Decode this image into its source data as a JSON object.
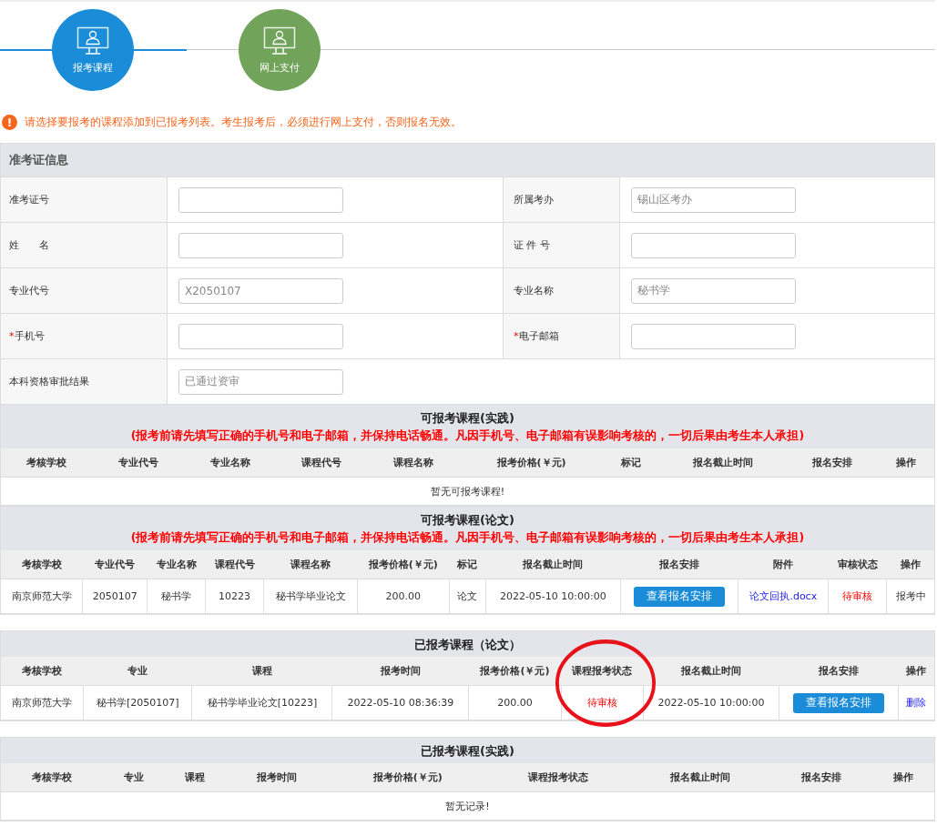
{
  "steps": [
    {
      "label": "报考课程",
      "color": "#1a8cd8"
    },
    {
      "label": "网上支付",
      "color": "#72a35a"
    }
  ],
  "notice": {
    "icon": "!",
    "text": "请选择要报考的课程添加到已报考列表。考生报考后，必须进行网上支付，否则报名无效。"
  },
  "form": {
    "title": "准考证信息",
    "rows": [
      [
        {
          "label": "准考证号"
        },
        {
          "label": "所属考办",
          "value": "锡山区考办"
        }
      ],
      [
        {
          "label": "姓　　名"
        },
        {
          "label": "证 件 号"
        }
      ],
      [
        {
          "label": "专业代号",
          "value": "X2050107"
        },
        {
          "label": "专业名称",
          "value": "秘书学"
        }
      ],
      [
        {
          "label": "手机号",
          "mark": "*"
        },
        {
          "label": "电子邮箱",
          "mark": "*"
        }
      ],
      [
        {
          "label": "本科资格审批结果",
          "value": "已通过资审"
        }
      ]
    ]
  },
  "sections": [
    {
      "title": "可报考课程(实践)",
      "warning": "(报考前请先填写正确的手机号和电子邮箱，并保持电话畅通。凡因手机号、电子邮箱有误影响考核的，一切后果由考生本人承担)",
      "columns": [
        "考核学校",
        "专业代号",
        "专业名称",
        "课程代号",
        "课程名称",
        "报考价格(￥元)",
        "标记",
        "报名截止时间",
        "报名安排",
        "操作"
      ],
      "empty": "暂无可报考课程!"
    },
    {
      "title": "可报考课程(论文)",
      "warning": "(报考前请先填写正确的手机号和电子邮箱，并保持电话畅通。凡因手机号、电子邮箱有误影响考核的，一切后果由考生本人承担)",
      "columns": [
        "考核学校",
        "专业代号",
        "专业名称",
        "课程代号",
        "课程名称",
        "报考价格(￥元)",
        "标记",
        "报名截止时间",
        "报名安排",
        "附件",
        "审核状态",
        "操作"
      ],
      "rows": [
        [
          {
            "kind": "text",
            "text": "南京师范大学"
          },
          {
            "kind": "text",
            "text": "2050107"
          },
          {
            "kind": "text",
            "text": "秘书学"
          },
          {
            "kind": "text",
            "text": "10223"
          },
          {
            "kind": "text",
            "text": "秘书学毕业论文"
          },
          {
            "kind": "text",
            "text": "200.00"
          },
          {
            "kind": "text",
            "text": "论文"
          },
          {
            "kind": "text",
            "text": "2022-05-10 10:00:00"
          },
          {
            "kind": "button",
            "text": "查看报名安排"
          },
          {
            "kind": "link",
            "text": "论文回执.docx"
          },
          {
            "kind": "status",
            "text": "待审核"
          },
          {
            "kind": "text",
            "text": "报考中"
          }
        ]
      ]
    },
    {
      "title": "已报考课程（论文）",
      "columns": [
        "考核学校",
        "专业",
        "课程",
        "报考时间",
        "报考价格(￥元)",
        "课程报考状态",
        "报名截止时间",
        "报名安排",
        "操作"
      ],
      "rows": [
        [
          {
            "kind": "text",
            "text": "南京师范大学"
          },
          {
            "kind": "text",
            "text": "秘书学[2050107]"
          },
          {
            "kind": "text",
            "text": "秘书学毕业论文[10223]"
          },
          {
            "kind": "text",
            "text": "2022-05-10 08:36:39"
          },
          {
            "kind": "text",
            "text": "200.00"
          },
          {
            "kind": "status",
            "text": "待审核",
            "circled": true
          },
          {
            "kind": "text",
            "text": "2022-05-10 10:00:00"
          },
          {
            "kind": "button",
            "text": "查看报名安排"
          },
          {
            "kind": "link",
            "text": "删除"
          }
        ]
      ]
    },
    {
      "title": "已报考课程(实践)",
      "columns": [
        "考核学校",
        "专业",
        "课程",
        "报考时间",
        "报考价格(￥元)",
        "课程报考状态",
        "报名截止时间",
        "报名安排",
        "操作"
      ],
      "empty": "暂无记录!"
    }
  ]
}
